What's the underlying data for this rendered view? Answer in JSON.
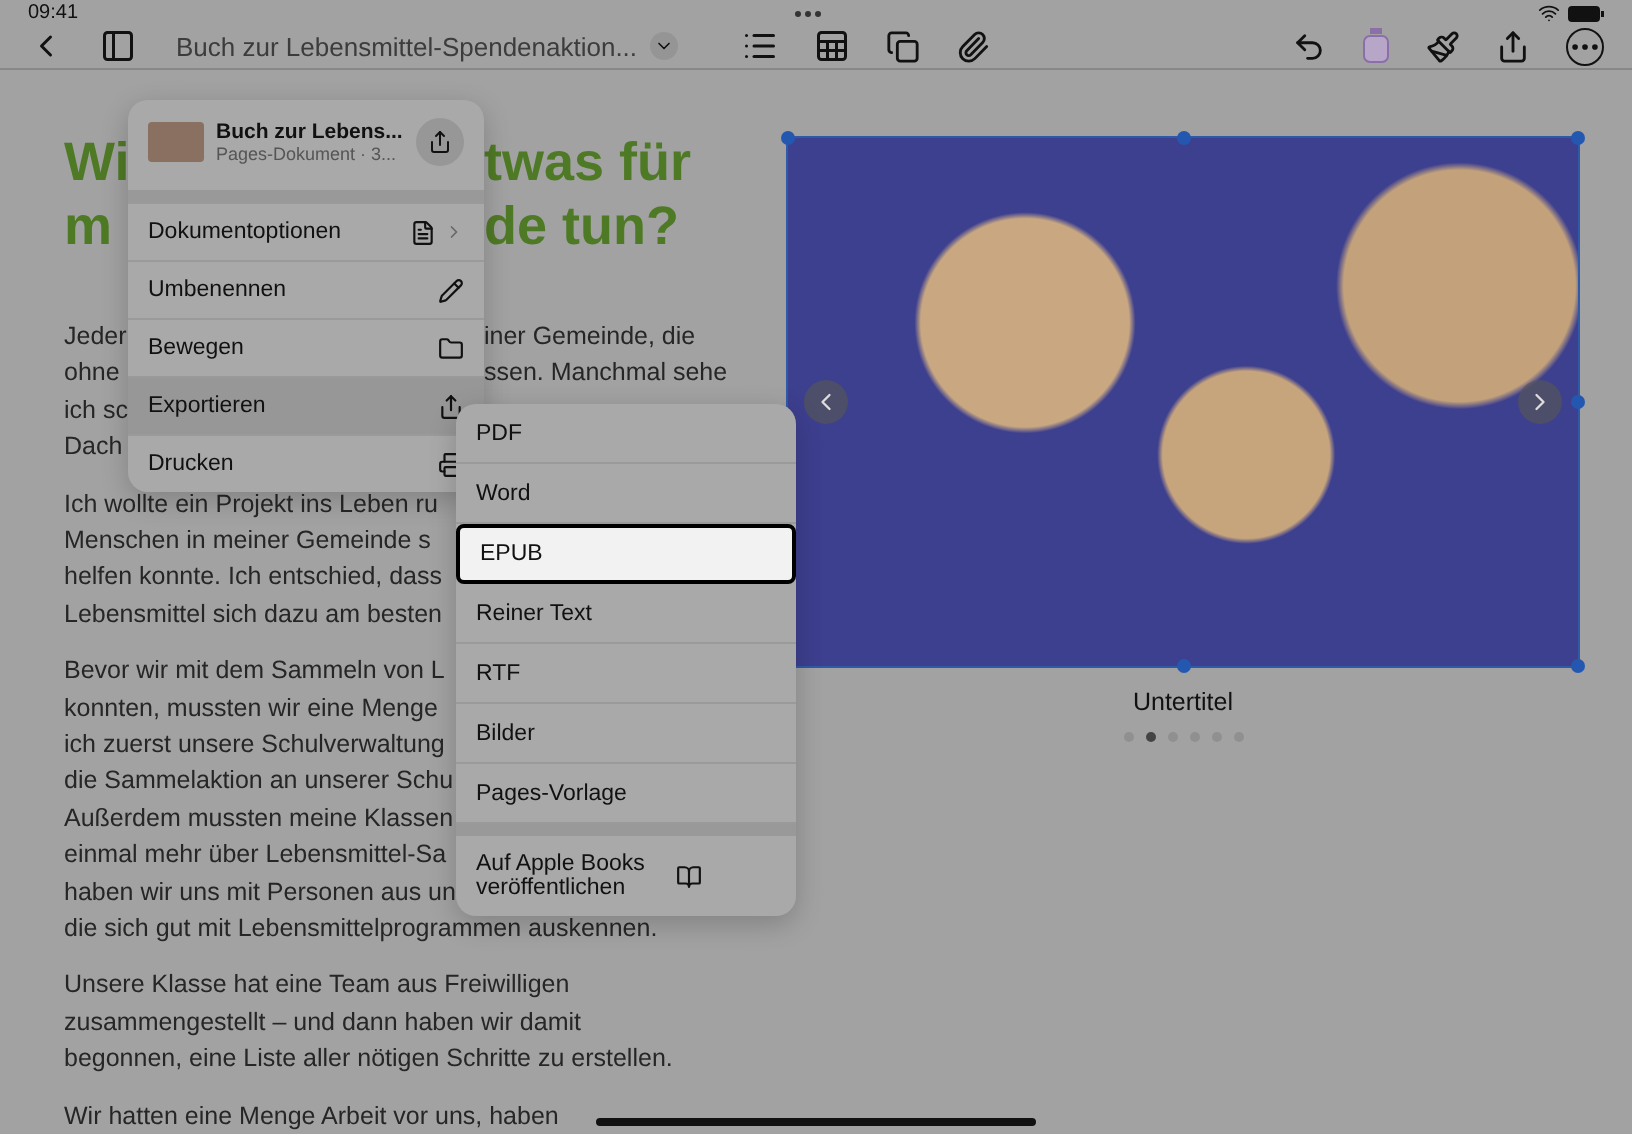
{
  "status_bar": {
    "time": "09:41"
  },
  "toolbar": {
    "title": "Buch zur Lebensmittel-Spendenaktion..."
  },
  "document": {
    "heading": [
      {
        "left": "Wi",
        "right": "twas für"
      },
      {
        "left": "m",
        "right": "de tun?"
      }
    ],
    "paragraphs": [
      [
        {
          "left": "Jeder",
          "right": "iner Gemeinde, die"
        },
        {
          "left": "ohne",
          "right": "ssen. Manchmal sehe"
        },
        {
          "left": "ich sc"
        },
        {
          "left": "Dach"
        }
      ],
      [
        {
          "left": "Ich wollte ein Projekt ins Leben ru"
        },
        {
          "left": "Menschen in meiner Gemeinde s"
        },
        {
          "left": "helfen konnte. Ich entschied, dass"
        },
        {
          "left": "Lebensmittel sich dazu am besten"
        }
      ],
      [
        {
          "left": "Bevor wir mit dem Sammeln von L"
        },
        {
          "left": "konnten, mussten wir eine Menge"
        },
        {
          "left": "ich zuerst unsere Schulverwaltung"
        },
        {
          "left": "die Sammelaktion an unserer Schu"
        },
        {
          "left": "Außerdem mussten meine Klassen"
        },
        {
          "left": "einmal mehr über Lebensmittel-Sa"
        },
        {
          "left": "haben wir uns mit Personen aus un"
        },
        {
          "left": "die sich gut mit Lebensmittelprogrammen auskennen."
        }
      ],
      [
        {
          "left": "Unsere Klasse hat eine Team aus Freiwilligen"
        },
        {
          "left": "zusammengestellt – und dann haben wir damit"
        },
        {
          "left": "begonnen, eine Liste aller nötigen Schritte zu erstellen."
        }
      ],
      [
        {
          "left": "Wir hatten eine Menge Arbeit vor uns, haben"
        }
      ]
    ]
  },
  "gallery": {
    "caption": "Untertitel",
    "dots": [
      {
        "selected": false
      },
      {
        "selected": true
      },
      {
        "selected": false
      },
      {
        "selected": false
      },
      {
        "selected": false
      },
      {
        "selected": false
      }
    ]
  },
  "file_menu": {
    "title": "Buch zur Lebens...",
    "subtitle": "Pages-Dokument · 3...",
    "items": [
      {
        "label": "Dokumentoptionen",
        "submenu": true,
        "selected": false
      },
      {
        "label": "Umbenennen",
        "submenu": false,
        "selected": false
      },
      {
        "label": "Bewegen",
        "submenu": false,
        "selected": false
      },
      {
        "label": "Exportieren",
        "submenu": false,
        "selected": true
      },
      {
        "label": "Drucken",
        "submenu": false,
        "selected": false
      }
    ]
  },
  "export_menu": {
    "formats": [
      {
        "label": "PDF",
        "selected": false
      },
      {
        "label": "Word",
        "selected": false
      },
      {
        "label": "EPUB",
        "selected": true
      },
      {
        "label": "Reiner Text",
        "selected": false
      },
      {
        "label": "RTF",
        "selected": false
      },
      {
        "label": "Bilder",
        "selected": false
      },
      {
        "label": "Pages-Vorlage",
        "selected": false
      }
    ],
    "publish": {
      "label": "Auf Apple Books veröffentlichen"
    }
  }
}
